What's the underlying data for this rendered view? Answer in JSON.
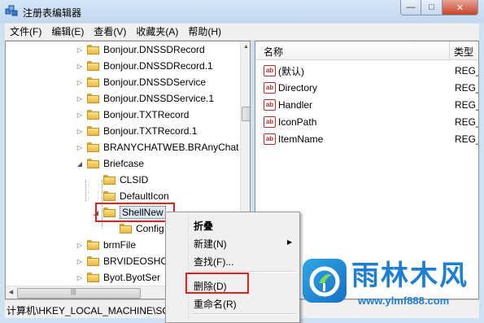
{
  "window": {
    "title": "注册表编辑器",
    "minimize_glyph": "—",
    "maximize_glyph": "□",
    "close_glyph": "✕"
  },
  "menubar": [
    "文件(F)",
    "编辑(E)",
    "查看(V)",
    "收藏夹(A)",
    "帮助(H)"
  ],
  "tree": {
    "items": [
      {
        "label": "Bonjour.DNSSDRecord",
        "level": 1,
        "expander": "▷"
      },
      {
        "label": "Bonjour.DNSSDRecord.1",
        "level": 1,
        "expander": "▷"
      },
      {
        "label": "Bonjour.DNSSDService",
        "level": 1,
        "expander": "▷"
      },
      {
        "label": "Bonjour.DNSSDService.1",
        "level": 1,
        "expander": "▷"
      },
      {
        "label": "Bonjour.TXTRecord",
        "level": 1,
        "expander": "▷"
      },
      {
        "label": "Bonjour.TXTRecord.1",
        "level": 1,
        "expander": "▷"
      },
      {
        "label": "BRANYCHATWEB.BRAnyChat",
        "level": 1,
        "expander": "▷"
      },
      {
        "label": "Briefcase",
        "level": 1,
        "expander": "◢"
      },
      {
        "label": "CLSID",
        "level": 2,
        "expander": ""
      },
      {
        "label": "DefaultIcon",
        "level": 2,
        "expander": ""
      },
      {
        "label": "ShellNew",
        "level": 2,
        "expander": "◢"
      },
      {
        "label": "Config",
        "level": 3,
        "expander": ""
      },
      {
        "label": "brmFile",
        "level": 1,
        "expander": "▷"
      },
      {
        "label": "BRVIDEOSHO",
        "level": 1,
        "expander": "▷"
      },
      {
        "label": "Byot.ByotSer",
        "level": 1,
        "expander": "▷"
      }
    ]
  },
  "list": {
    "columns": {
      "name": "名称",
      "type": "类型"
    },
    "values": [
      {
        "name": "(默认)",
        "type": "REG_",
        "icon": "ab-string-icon"
      },
      {
        "name": "Directory",
        "type": "REG_",
        "icon": "ab-string-icon"
      },
      {
        "name": "Handler",
        "type": "REG_",
        "icon": "ab-string-icon"
      },
      {
        "name": "IconPath",
        "type": "REG_",
        "icon": "ab-string-icon"
      },
      {
        "name": "ItemName",
        "type": "REG_",
        "icon": "ab-string-icon"
      }
    ]
  },
  "context_menu": {
    "items": [
      {
        "label": "折叠",
        "bold": true
      },
      {
        "label": "新建(N)",
        "submenu": true
      },
      {
        "label": "查找(F)..."
      },
      {
        "label": "删除(D)"
      },
      {
        "label": "重命名(R)"
      }
    ]
  },
  "statusbar": {
    "path": "计算机\\HKEY_LOCAL_MACHINE\\SO"
  },
  "watermark": {
    "title": "雨林木风",
    "url": "www.ylmf888.com"
  },
  "colors": {
    "highlight_box": "#e32020",
    "watermark": "#1d7fd3"
  }
}
